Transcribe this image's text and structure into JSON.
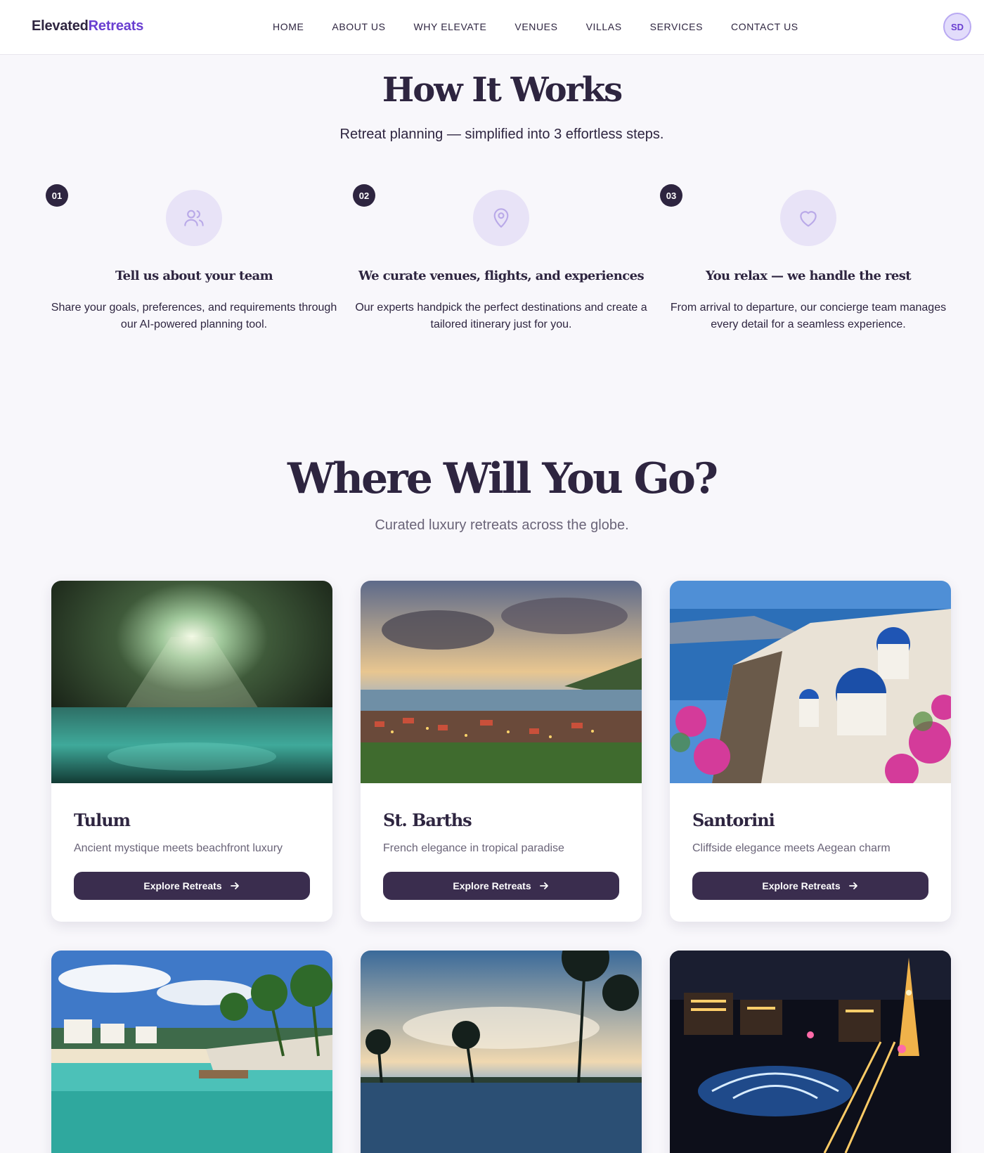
{
  "brand": {
    "part1": "Elevated",
    "part2": "Retreats"
  },
  "nav": {
    "items": [
      "HOME",
      "ABOUT US",
      "WHY ELEVATE",
      "VENUES",
      "VILLAS",
      "SERVICES",
      "CONTACT US"
    ],
    "avatar_initials": "SD"
  },
  "how_it_works": {
    "title": "How It Works",
    "subtitle": "Retreat planning — simplified into 3 effortless steps.",
    "steps": [
      {
        "number": "01",
        "icon": "users-icon",
        "title": "Tell us about your team",
        "description": "Share your goals, preferences, and requirements through our AI-powered planning tool."
      },
      {
        "number": "02",
        "icon": "map-pin-icon",
        "title": "We curate venues, flights, and experiences",
        "description": "Our experts handpick the perfect destinations and create a tailored itinerary just for you."
      },
      {
        "number": "03",
        "icon": "heart-icon",
        "title": "You relax — we handle the rest",
        "description": "From arrival to departure, our concierge team manages every detail for a seamless experience."
      }
    ]
  },
  "destinations": {
    "title": "Where Will You Go?",
    "subtitle": "Curated luxury retreats across the globe.",
    "button_label": "Explore Retreats",
    "cards": [
      {
        "name": "Tulum",
        "tagline": "Ancient mystique meets beachfront luxury"
      },
      {
        "name": "St. Barths",
        "tagline": "French elegance in tropical paradise"
      },
      {
        "name": "Santorini",
        "tagline": "Cliffside elegance meets Aegean charm"
      },
      {
        "name": "",
        "tagline": ""
      },
      {
        "name": "",
        "tagline": ""
      },
      {
        "name": "",
        "tagline": ""
      }
    ]
  },
  "colors": {
    "brand_dark": "#2e2540",
    "brand_accent": "#6a3fd1",
    "button": "#3a2d4e",
    "icon_circle": "#e8e3f7",
    "muted_text": "#6a6478"
  }
}
